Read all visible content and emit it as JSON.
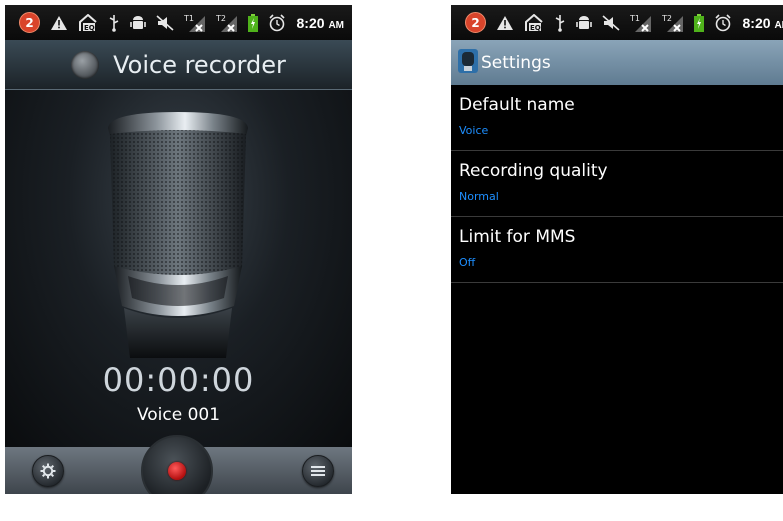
{
  "status_bar": {
    "notification_count": "2",
    "time": "8:20",
    "ampm": "AM",
    "icons": [
      "notification-badge",
      "warning-icon",
      "eq-icon",
      "usb-icon",
      "android-debug-icon",
      "mute-icon",
      "signal-sim1-icon",
      "signal-sim2-icon",
      "battery-icon",
      "alarm-icon"
    ]
  },
  "voice_recorder": {
    "title": "Voice recorder",
    "timer": "00:00:00",
    "file_name": "Voice 001"
  },
  "settings": {
    "title": "Settings",
    "items": [
      {
        "label": "Default name",
        "value": "Voice"
      },
      {
        "label": "Recording quality",
        "value": "Normal"
      },
      {
        "label": "Limit for MMS",
        "value": "Off"
      }
    ]
  },
  "colors": {
    "accent_value": "#1e8fff",
    "record": "#d01818",
    "settings_titlebar": "#6f8ba2"
  }
}
